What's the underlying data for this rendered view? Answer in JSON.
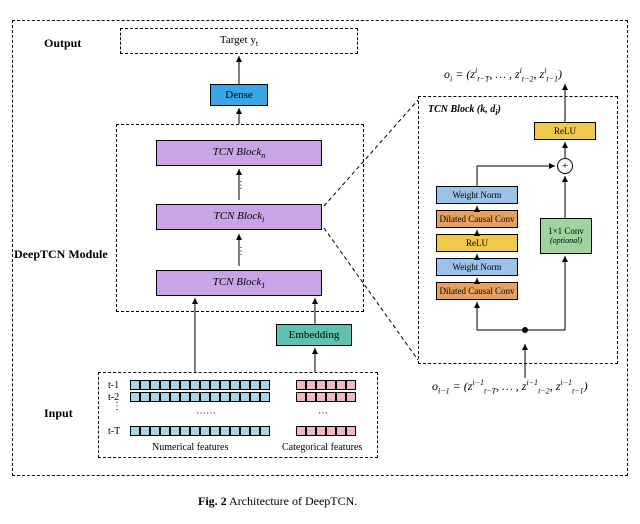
{
  "output_label": "Output",
  "target_label": "Target y",
  "target_sub": "t",
  "dense_label": "Dense",
  "module_label": "DeepTCN Module",
  "tcn_n": "TCN Block",
  "tcn_n_sub": "n",
  "tcn_i": "TCN Block",
  "tcn_i_sub": "i",
  "tcn_1": "TCN Block",
  "tcn_1_sub": "1",
  "embedding": "Embedding",
  "input_label": "Input",
  "time_labels": {
    "t1": "t-1",
    "t2": "t-2",
    "tT": "t-T"
  },
  "num_feat": "Numerical features",
  "cat_feat": "Categorical  features",
  "caption_prefix": "Fig. 2",
  "caption_rest": " Architecture of DeepTCN.",
  "detail": {
    "title": "TCN Block (k, d",
    "title_sub": "i",
    "title_end": ")",
    "relu": "ReLU",
    "wn": "Weight Norm",
    "dcc": "Dilated Causal Conv",
    "conv1": "1×1 Conv",
    "conv1_opt": "(optional)",
    "plus": "+"
  },
  "formulas": {
    "o_top": "o",
    "o_top_sub": "i",
    "o_top_eq": " = (z",
    "z_tT_sup": "i",
    "z_tT_sub": "t−T",
    "z_t2_sup": "i",
    "z_t2_sub": "t−2",
    "z_t1_sup": "i",
    "z_t1_sub": "t−1",
    "o_bot_sub": "i−1",
    "zb_sup": "i−1"
  }
}
